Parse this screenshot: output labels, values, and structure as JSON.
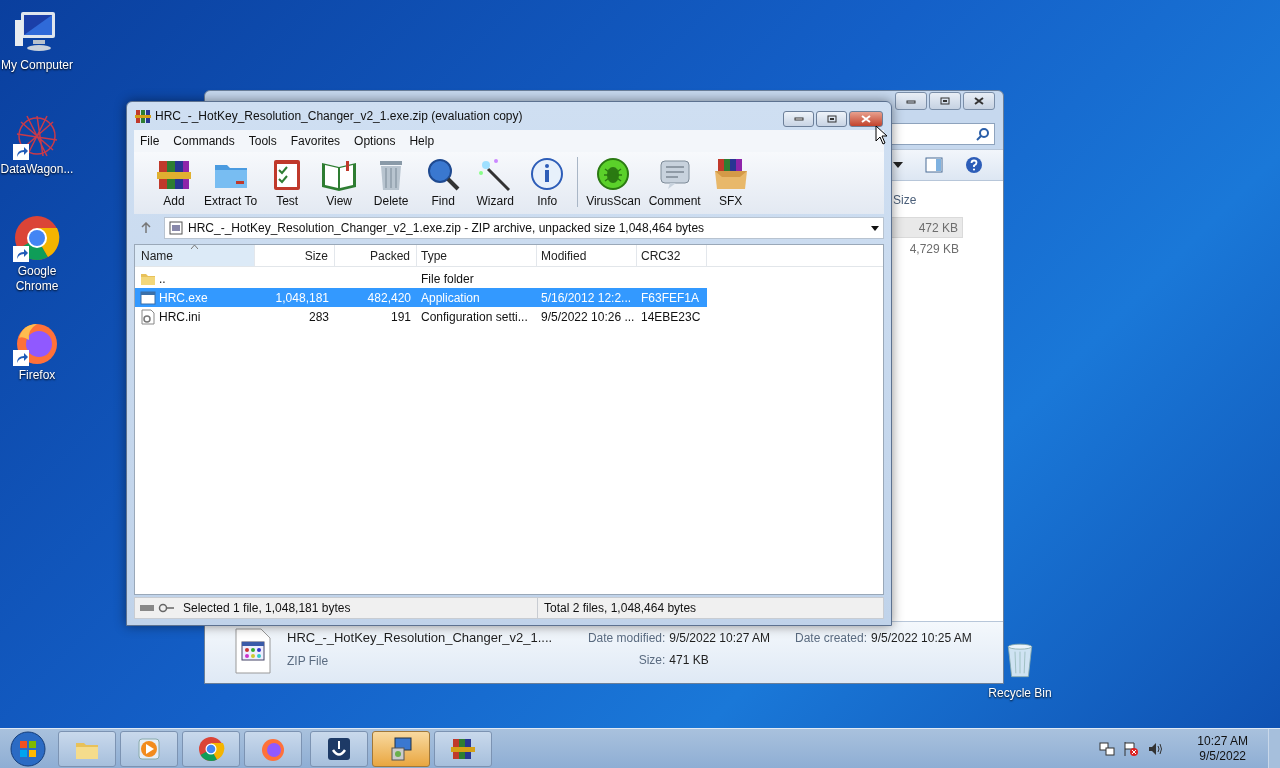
{
  "desktop_icons": [
    {
      "label": "My Computer",
      "kind": "computer",
      "shortcut": false
    },
    {
      "label": "DataWagon...",
      "kind": "star",
      "shortcut": true
    },
    {
      "label": "Google Chrome",
      "kind": "chrome",
      "shortcut": true
    },
    {
      "label": "Firefox",
      "kind": "firefox",
      "shortcut": true
    },
    {
      "label": "Recycle Bin",
      "kind": "bin",
      "shortcut": false
    }
  ],
  "explorer_window": {
    "column_header": "Size",
    "sizes": [
      {
        "text": "472 KB",
        "selected": true
      },
      {
        "text": "4,729 KB",
        "selected": false
      }
    ],
    "details": {
      "name": "HRC_-_HotKey_Resolution_Changer_v2_1....",
      "type": "ZIP File",
      "modified_label": "Date modified:",
      "modified": "9/5/2022 10:27 AM",
      "size_label": "Size:",
      "size": "471 KB",
      "created_label": "Date created:",
      "created": "9/5/2022 10:25 AM"
    }
  },
  "winrar_window": {
    "title": "HRC_-_HotKey_Resolution_Changer_v2_1.exe.zip (evaluation copy)",
    "menu": [
      "File",
      "Commands",
      "Tools",
      "Favorites",
      "Options",
      "Help"
    ],
    "toolbar": [
      {
        "label": "Add",
        "kind": "add"
      },
      {
        "label": "Extract To",
        "kind": "extract"
      },
      {
        "label": "Test",
        "kind": "test"
      },
      {
        "label": "View",
        "kind": "view"
      },
      {
        "label": "Delete",
        "kind": "delete"
      },
      {
        "label": "Find",
        "kind": "find"
      },
      {
        "label": "Wizard",
        "kind": "wizard"
      },
      {
        "label": "Info",
        "kind": "info"
      },
      {
        "label": "VirusScan",
        "kind": "virus"
      },
      {
        "label": "Comment",
        "kind": "comment"
      },
      {
        "label": "SFX",
        "kind": "sfx"
      }
    ],
    "path": "HRC_-_HotKey_Resolution_Changer_v2_1.exe.zip - ZIP archive, unpacked size 1,048,464 bytes",
    "columns": [
      {
        "label": "Name",
        "sorted": true
      },
      {
        "label": "Size",
        "sorted": false
      },
      {
        "label": "Packed",
        "sorted": false
      },
      {
        "label": "Type",
        "sorted": false
      },
      {
        "label": "Modified",
        "sorted": false
      },
      {
        "label": "CRC32",
        "sorted": false
      }
    ],
    "rows": [
      {
        "kind": "folder",
        "name": "..",
        "size": "",
        "packed": "",
        "type": "File folder",
        "modified": "",
        "crc32": "",
        "selected": false
      },
      {
        "kind": "exe",
        "name": "HRC.exe",
        "size": "1,048,181",
        "packed": "482,420",
        "type": "Application",
        "modified": "5/16/2012 12:2...",
        "crc32": "F63FEF1A",
        "selected": true
      },
      {
        "kind": "ini",
        "name": "HRC.ini",
        "size": "283",
        "packed": "191",
        "type": "Configuration setti...",
        "modified": "9/5/2022 10:26 ...",
        "crc32": "14EBE23C",
        "selected": false
      }
    ],
    "status": [
      "Selected 1 file, 1,048,181 bytes",
      "Total 2 files, 1,048,464 bytes"
    ]
  },
  "taskbar": {
    "items": [
      {
        "kind": "explorer",
        "selected": false
      },
      {
        "kind": "media",
        "selected": false
      },
      {
        "kind": "chrome",
        "selected": false
      },
      {
        "kind": "firefox",
        "selected": false
      },
      {
        "kind": "app",
        "selected": false
      },
      {
        "kind": "installer",
        "selected": true
      },
      {
        "kind": "winrar",
        "selected": false
      }
    ],
    "time": "10:27 AM",
    "date": "9/5/2022"
  }
}
